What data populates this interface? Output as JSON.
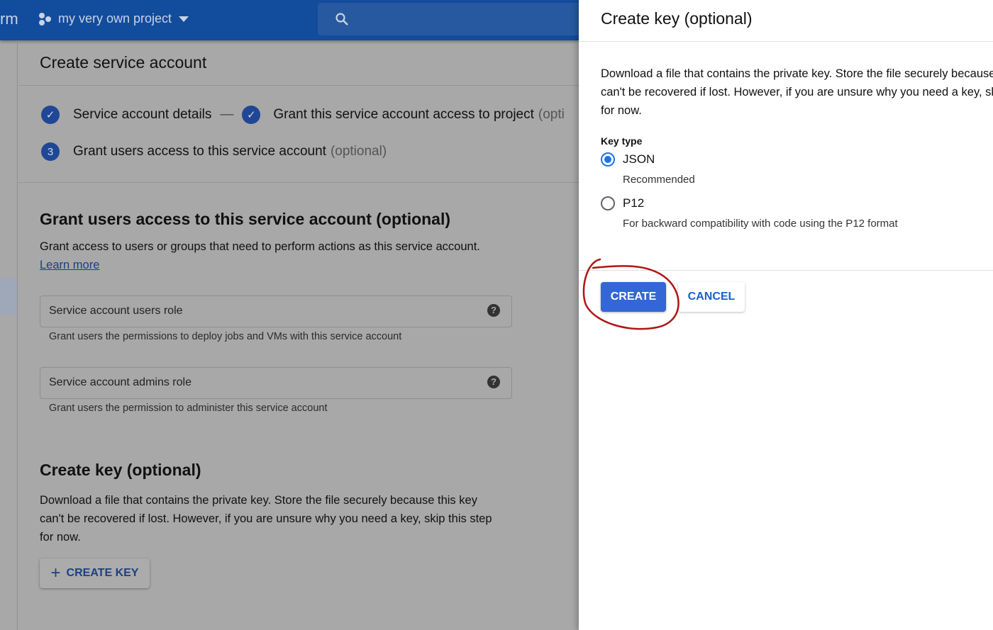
{
  "topbar": {
    "brand_fragment": "rm",
    "project": "my very own project"
  },
  "main": {
    "title": "Create service account",
    "steps": [
      {
        "label": "Service account details",
        "status": "done"
      },
      {
        "label": "Grant this service account access to project",
        "suffix": "(opti",
        "status": "done"
      },
      {
        "number": "3",
        "label": "Grant users access to this service account",
        "suffix": "(optional)",
        "status": "current"
      }
    ],
    "section_title": "Grant users access to this service account (optional)",
    "section_desc": "Grant access to users or groups that need to perform actions as this service account.",
    "learn_more": "Learn more",
    "fields": [
      {
        "label": "Service account users role",
        "hint": "Grant users the permissions to deploy jobs and VMs with this service account"
      },
      {
        "label": "Service account admins role",
        "hint": "Grant users the permission to administer this service account"
      }
    ],
    "key_title": "Create key (optional)",
    "key_desc": [
      "Download a file that contains the private key. Store the file securely because this key",
      "can't be recovered if lost. However, if you are unsure why you need a key, skip this step",
      "for now."
    ],
    "create_key_button": "CREATE KEY"
  },
  "panel": {
    "title": "Create key (optional)",
    "desc": [
      "Download a file that contains the private key. Store the file securely because this key",
      "can't be recovered if lost. However, if you are unsure why you need a key, skip this step",
      "for now."
    ],
    "key_type_label": "Key type",
    "options": [
      {
        "label": "JSON",
        "desc": "Recommended",
        "selected": true
      },
      {
        "label": "P12",
        "desc": "For backward compatibility with code using the P12 format",
        "selected": false
      }
    ],
    "create_button": "CREATE",
    "cancel_button": "CANCEL"
  },
  "colors": {
    "accent": "#1a73e8",
    "annotation": "#b01515"
  }
}
